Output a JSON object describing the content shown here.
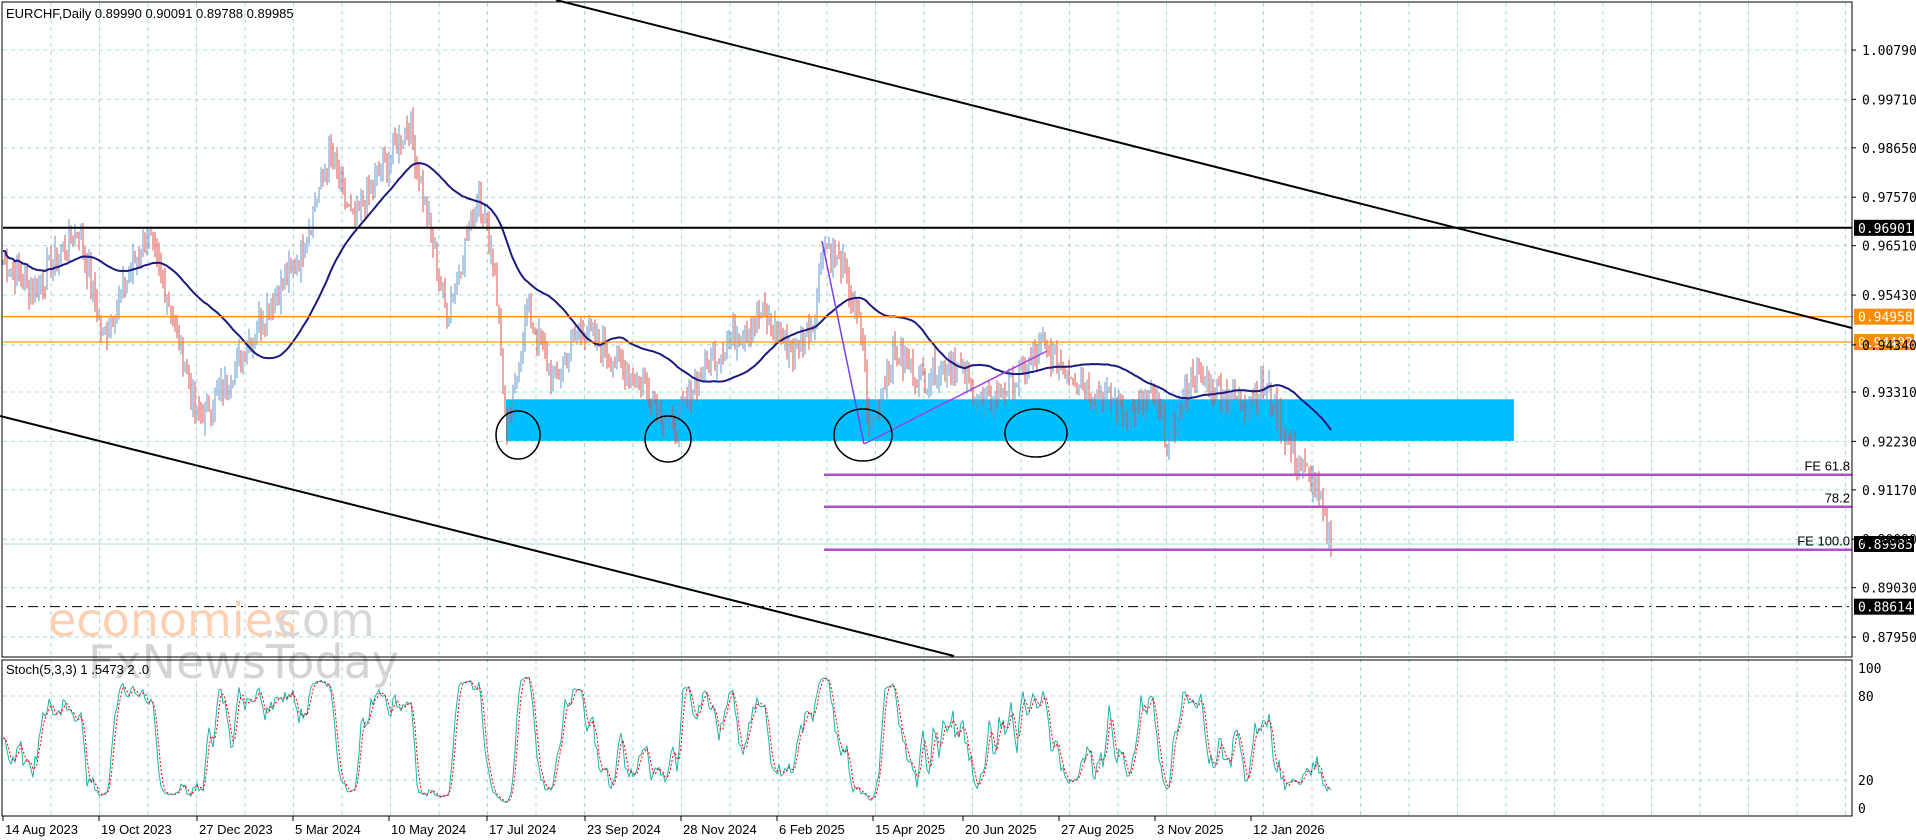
{
  "header": {
    "symbol_label": "EURCHF,Daily  0.89990 0.90091 0.89788 0.89985"
  },
  "stoch_label": "Stoch(5,3,3) 1 .5473 2 .0",
  "watermark": {
    "line1a": "economies",
    "line1b": ".com",
    "line2": "FxNewsToday"
  },
  "colors": {
    "bull": "#6699cc",
    "bear": "#e0504f",
    "ma": "#1a1a80",
    "zone": "#00bfff",
    "orange": "#ff8c00",
    "fib": "#b04fc8",
    "stoch_main": "#20b2aa",
    "stoch_signal": "#ff0000",
    "grid": "#a9d8d8"
  },
  "chart_data": {
    "type": "candlestick",
    "title": "EURCHF, Daily",
    "ylim": [
      0.876,
      1.0185
    ],
    "price_ticks": [
      "1.00790",
      "0.99710",
      "0.98650",
      "0.97570",
      "0.96510",
      "0.95430",
      "0.94340",
      "0.93310",
      "0.92230",
      "0.91170",
      "0.90090",
      "0.89030",
      "0.87950"
    ],
    "price_tick_values": [
      1.0079,
      0.9971,
      0.9865,
      0.9757,
      0.9651,
      0.9543,
      0.9434,
      0.9331,
      0.9223,
      0.9117,
      0.9009,
      0.8903,
      0.8795
    ],
    "date_ticks": [
      "14 Aug 2023",
      "19 Oct 2023",
      "27 Dec 2023",
      "5 Mar 2024",
      "10 May 2024",
      "17 Jul 2024",
      "23 Sep 2024",
      "28 Nov 2024",
      "6 Feb 2025",
      "15 Apr 2025",
      "20 Jun 2025",
      "27 Aug 2025",
      "3 Nov 2025",
      "12 Jan 2026"
    ],
    "date_tick_bars": [
      0,
      48,
      97,
      145,
      193,
      242,
      291,
      339,
      387,
      435,
      480,
      528,
      576,
      624
    ],
    "close_path": [
      [
        0,
        0.962
      ],
      [
        15,
        0.955
      ],
      [
        38,
        0.969
      ],
      [
        50,
        0.945
      ],
      [
        72,
        0.968
      ],
      [
        85,
        0.95
      ],
      [
        97,
        0.927
      ],
      [
        112,
        0.935
      ],
      [
        130,
        0.95
      ],
      [
        148,
        0.962
      ],
      [
        163,
        0.985
      ],
      [
        175,
        0.97
      ],
      [
        185,
        0.978
      ],
      [
        203,
        0.992
      ],
      [
        212,
        0.972
      ],
      [
        222,
        0.95
      ],
      [
        238,
        0.977
      ],
      [
        246,
        0.96
      ],
      [
        252,
        0.922
      ],
      [
        262,
        0.952
      ],
      [
        275,
        0.935
      ],
      [
        290,
        0.948
      ],
      [
        305,
        0.94
      ],
      [
        320,
        0.935
      ],
      [
        335,
        0.925
      ],
      [
        350,
        0.938
      ],
      [
        365,
        0.945
      ],
      [
        380,
        0.95
      ],
      [
        395,
        0.942
      ],
      [
        405,
        0.948
      ],
      [
        410,
        0.966
      ],
      [
        420,
        0.96
      ],
      [
        430,
        0.945
      ],
      [
        433,
        0.924
      ],
      [
        445,
        0.942
      ],
      [
        460,
        0.936
      ],
      [
        475,
        0.94
      ],
      [
        490,
        0.93
      ],
      [
        505,
        0.935
      ],
      [
        520,
        0.943
      ],
      [
        535,
        0.937
      ],
      [
        550,
        0.932
      ],
      [
        565,
        0.928
      ],
      [
        575,
        0.932
      ],
      [
        583,
        0.922
      ],
      [
        595,
        0.937
      ],
      [
        605,
        0.934
      ],
      [
        620,
        0.931
      ],
      [
        632,
        0.934
      ],
      [
        640,
        0.925
      ],
      [
        648,
        0.917
      ],
      [
        656,
        0.913
      ],
      [
        664,
        0.8999
      ]
    ],
    "levels": [
      {
        "price": 0.96901,
        "label": "0.96901",
        "kind": "black"
      },
      {
        "price": 0.94958,
        "label": "0.94958",
        "kind": "orange"
      },
      {
        "price": 0.94402,
        "label": "0.94402",
        "kind": "orange"
      },
      {
        "price": 0.89985,
        "label": "0.89985",
        "kind": "current"
      },
      {
        "price": 0.88614,
        "label": "0.88614",
        "kind": "dashdot"
      }
    ],
    "fib_levels": [
      {
        "price": 0.915,
        "label": "FE 61.8"
      },
      {
        "price": 0.908,
        "label": "78.2"
      },
      {
        "price": 0.8986,
        "label": "FE 100.0"
      }
    ],
    "support_zone": [
      0.9224,
      0.9315
    ],
    "stoch": {
      "params": "5,3,3",
      "ylim": [
        0,
        100
      ],
      "ticks": [
        "100",
        "80",
        "20",
        "0"
      ],
      "tick_values": [
        100,
        80,
        20,
        0
      ]
    }
  }
}
